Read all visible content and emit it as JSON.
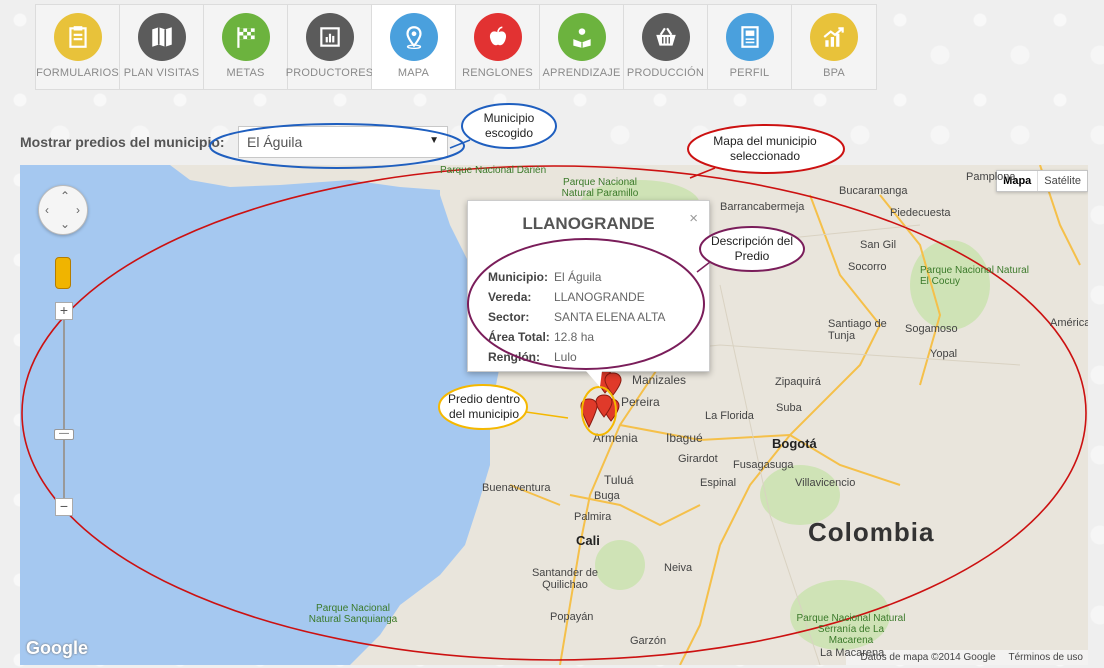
{
  "nav": [
    {
      "label": "FORMULARIOS",
      "icon": "clipboard-icon",
      "color": "#e8c23a"
    },
    {
      "label": "PLAN VISITAS",
      "icon": "folded-map-icon",
      "color": "#5b5b5b"
    },
    {
      "label": "METAS",
      "icon": "checkered-flag-icon",
      "color": "#6cb33e"
    },
    {
      "label": "PRODUCTORES",
      "icon": "grid-icon",
      "color": "#5b5b5b"
    },
    {
      "label": "MAPA",
      "icon": "map-pin-icon",
      "color": "#4aa0dd"
    },
    {
      "label": "RENGLONES",
      "icon": "apple-icon",
      "color": "#e23232"
    },
    {
      "label": "APRENDIZAJE",
      "icon": "reader-icon",
      "color": "#6cb33e"
    },
    {
      "label": "PRODUCCIÓN",
      "icon": "basket-icon",
      "color": "#5b5b5b"
    },
    {
      "label": "PERFIL",
      "icon": "document-icon",
      "color": "#4aa0dd"
    },
    {
      "label": "BPA",
      "icon": "chart-up-icon",
      "color": "#e8c23a"
    }
  ],
  "selector": {
    "label": "Mostrar predios del municipio:",
    "value": "El Águila"
  },
  "map": {
    "type_map": "Mapa",
    "type_satellite": "Satélite",
    "logo": "Google",
    "footer_data": "Datos de mapa ©2014 Google",
    "footer_terms": "Términos de uso",
    "places": {
      "bucaramanga": "Bucaramanga",
      "barrancabermeja": "Barrancabermeja",
      "piedecuesta": "Piedecuesta",
      "pamplona": "Pamplona",
      "sangil": "San Gil",
      "cocuy": "Parque Nacional Natural El Cocuy",
      "socorro": "Socorro",
      "tunja": "Santiago de Tunja",
      "sogamoso": "Sogamoso",
      "yopal": "Yopal",
      "zipaquira": "Zipaquirá",
      "manizales": "Manizales",
      "pereira": "Pereira",
      "ladorada": "La Florida",
      "suba": "Suba",
      "bogota": "Bogotá",
      "armenia": "Armenia",
      "ibague": "Ibagué",
      "girardot": "Girardot",
      "fusagasuga": "Fusagasuga",
      "espinal": "Espinal",
      "villavicencio": "Villavicencio",
      "buenaventura": "Buenaventura",
      "tulua": "Tuluá",
      "buga": "Buga",
      "palmira": "Palmira",
      "cali": "Cali",
      "neiva": "Neiva",
      "colombia": "Colombia",
      "america": "América",
      "paramillo": "Parque Nacional Natural Paramillo",
      "darien": "Parque Nacional Darién",
      "sanquianga": "Parque Nacional Natural Sanquianga",
      "quilichao": "Santander de Quilichao",
      "popayan": "Popayán",
      "garzon": "Garzón",
      "serrania": "Parque Nacional Natural Serranía de La Macarena",
      "lamacarena": "La Macarena"
    }
  },
  "infowindow": {
    "title": "LLANOGRANDE",
    "close": "×",
    "rows": [
      {
        "k": "Municipio:",
        "v": "El Águila"
      },
      {
        "k": "Vereda:",
        "v": "LLANOGRANDE"
      },
      {
        "k": "Sector:",
        "v": "SANTA ELENA ALTA"
      },
      {
        "k": "Área Total:",
        "v": "12.8 ha"
      },
      {
        "k": "Renglón:",
        "v": "Lulo"
      }
    ]
  },
  "annotations": {
    "municipio": "Municipio escogido",
    "mapa": "Mapa del municipio seleccionado",
    "descripcion": "Descripción del Predio",
    "predio": "Predio dentro del municipio"
  },
  "colors": {
    "ocean": "#a5c8f0",
    "land": "#e9e5dc",
    "road": "#f5c04a",
    "highlight_red": "#cc1111",
    "highlight_blue": "#1f5fbf",
    "highlight_purple": "#7a1d5a",
    "highlight_yellow": "#f5b800",
    "marker": "#e03a2a"
  }
}
